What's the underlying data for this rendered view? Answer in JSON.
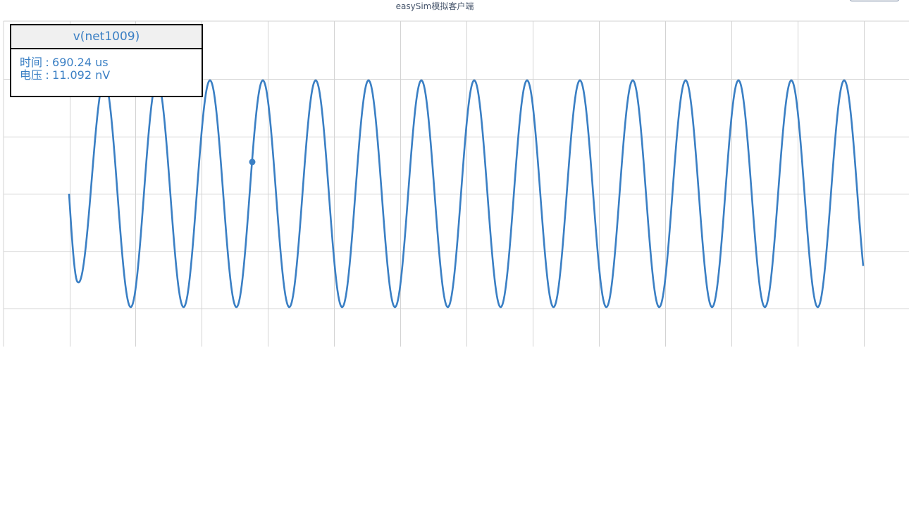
{
  "app": {
    "subtitle": "easySim模拟客户端"
  },
  "tooltip": {
    "series_name": "v(net1009)",
    "time_label": "时间",
    "time_value": "690.24 us",
    "voltage_label": "电压",
    "voltage_value": "11.092 nV",
    "separator": ":"
  },
  "colors": {
    "series": "#3a7fc4",
    "grid": "#d3d3d3",
    "tooltip_border": "#000000",
    "tooltip_header_bg": "#f0f0f0"
  },
  "chart_data": {
    "type": "line",
    "series": [
      {
        "name": "v(net1009)",
        "phase_start_deg": 180,
        "cycles": 15,
        "initial_dip_min": -0.78,
        "amplitude": 1.0
      }
    ],
    "ylim": [
      -1.2,
      1.2
    ],
    "grid": true,
    "x_gridline_count": 14,
    "y_gridline_count": 6,
    "hover_point": {
      "cycle_fraction": 3.45,
      "value": 0.28
    }
  }
}
